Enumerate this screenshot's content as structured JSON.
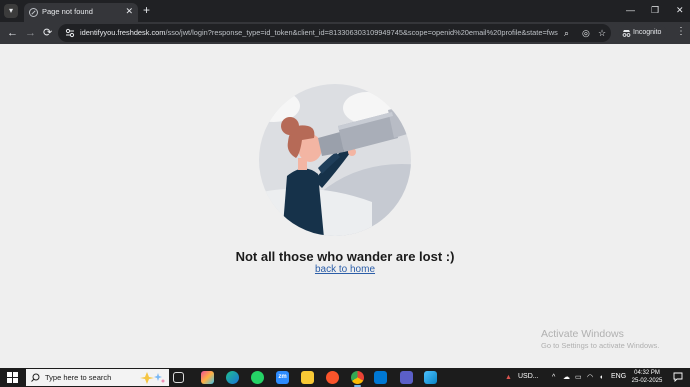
{
  "browser": {
    "tab": {
      "title": "Page not found",
      "close_glyph": "✕"
    },
    "new_tab_glyph": "+",
    "window_controls": {
      "minimize": "—",
      "maximize": "❐",
      "close": "✕"
    },
    "nav": {
      "back": "←",
      "forward": "→",
      "reload": "⟳"
    },
    "url": {
      "host": "identifyyou.freshdesk.com",
      "rest": "/sso/jwt/login?response_type=id_token&client_id=813306303109949745&scope=openid%20email%20profile&state=fwst_ae..."
    },
    "incognito_label": "Incognito",
    "icons": [
      "site-info-icon",
      "eye-off-icon",
      "bookmark-star-icon",
      "menu-dots-icon",
      "incognito-icon"
    ]
  },
  "page": {
    "message": "Not all those who wander are lost :)",
    "link": "back to home",
    "watermark": {
      "title": "Activate Windows",
      "subtitle": "Go to Settings to activate Windows."
    },
    "colors": {
      "background": "#efefef",
      "link": "#2c5ea8",
      "illustration_circle": "#dcdee2",
      "jacket": "#16324a",
      "hair": "#b66a57"
    }
  },
  "taskbar": {
    "search_placeholder": "Type here to search",
    "apps": [
      "task-view",
      "color-app",
      "edge",
      "whatsapp",
      "zoom",
      "file-explorer",
      "brave",
      "chrome",
      "vscode",
      "teams",
      "gallery"
    ],
    "tray": {
      "currency": "USD...",
      "language": "ENG",
      "time": "04:32 PM",
      "date": "25-02-2025"
    }
  }
}
